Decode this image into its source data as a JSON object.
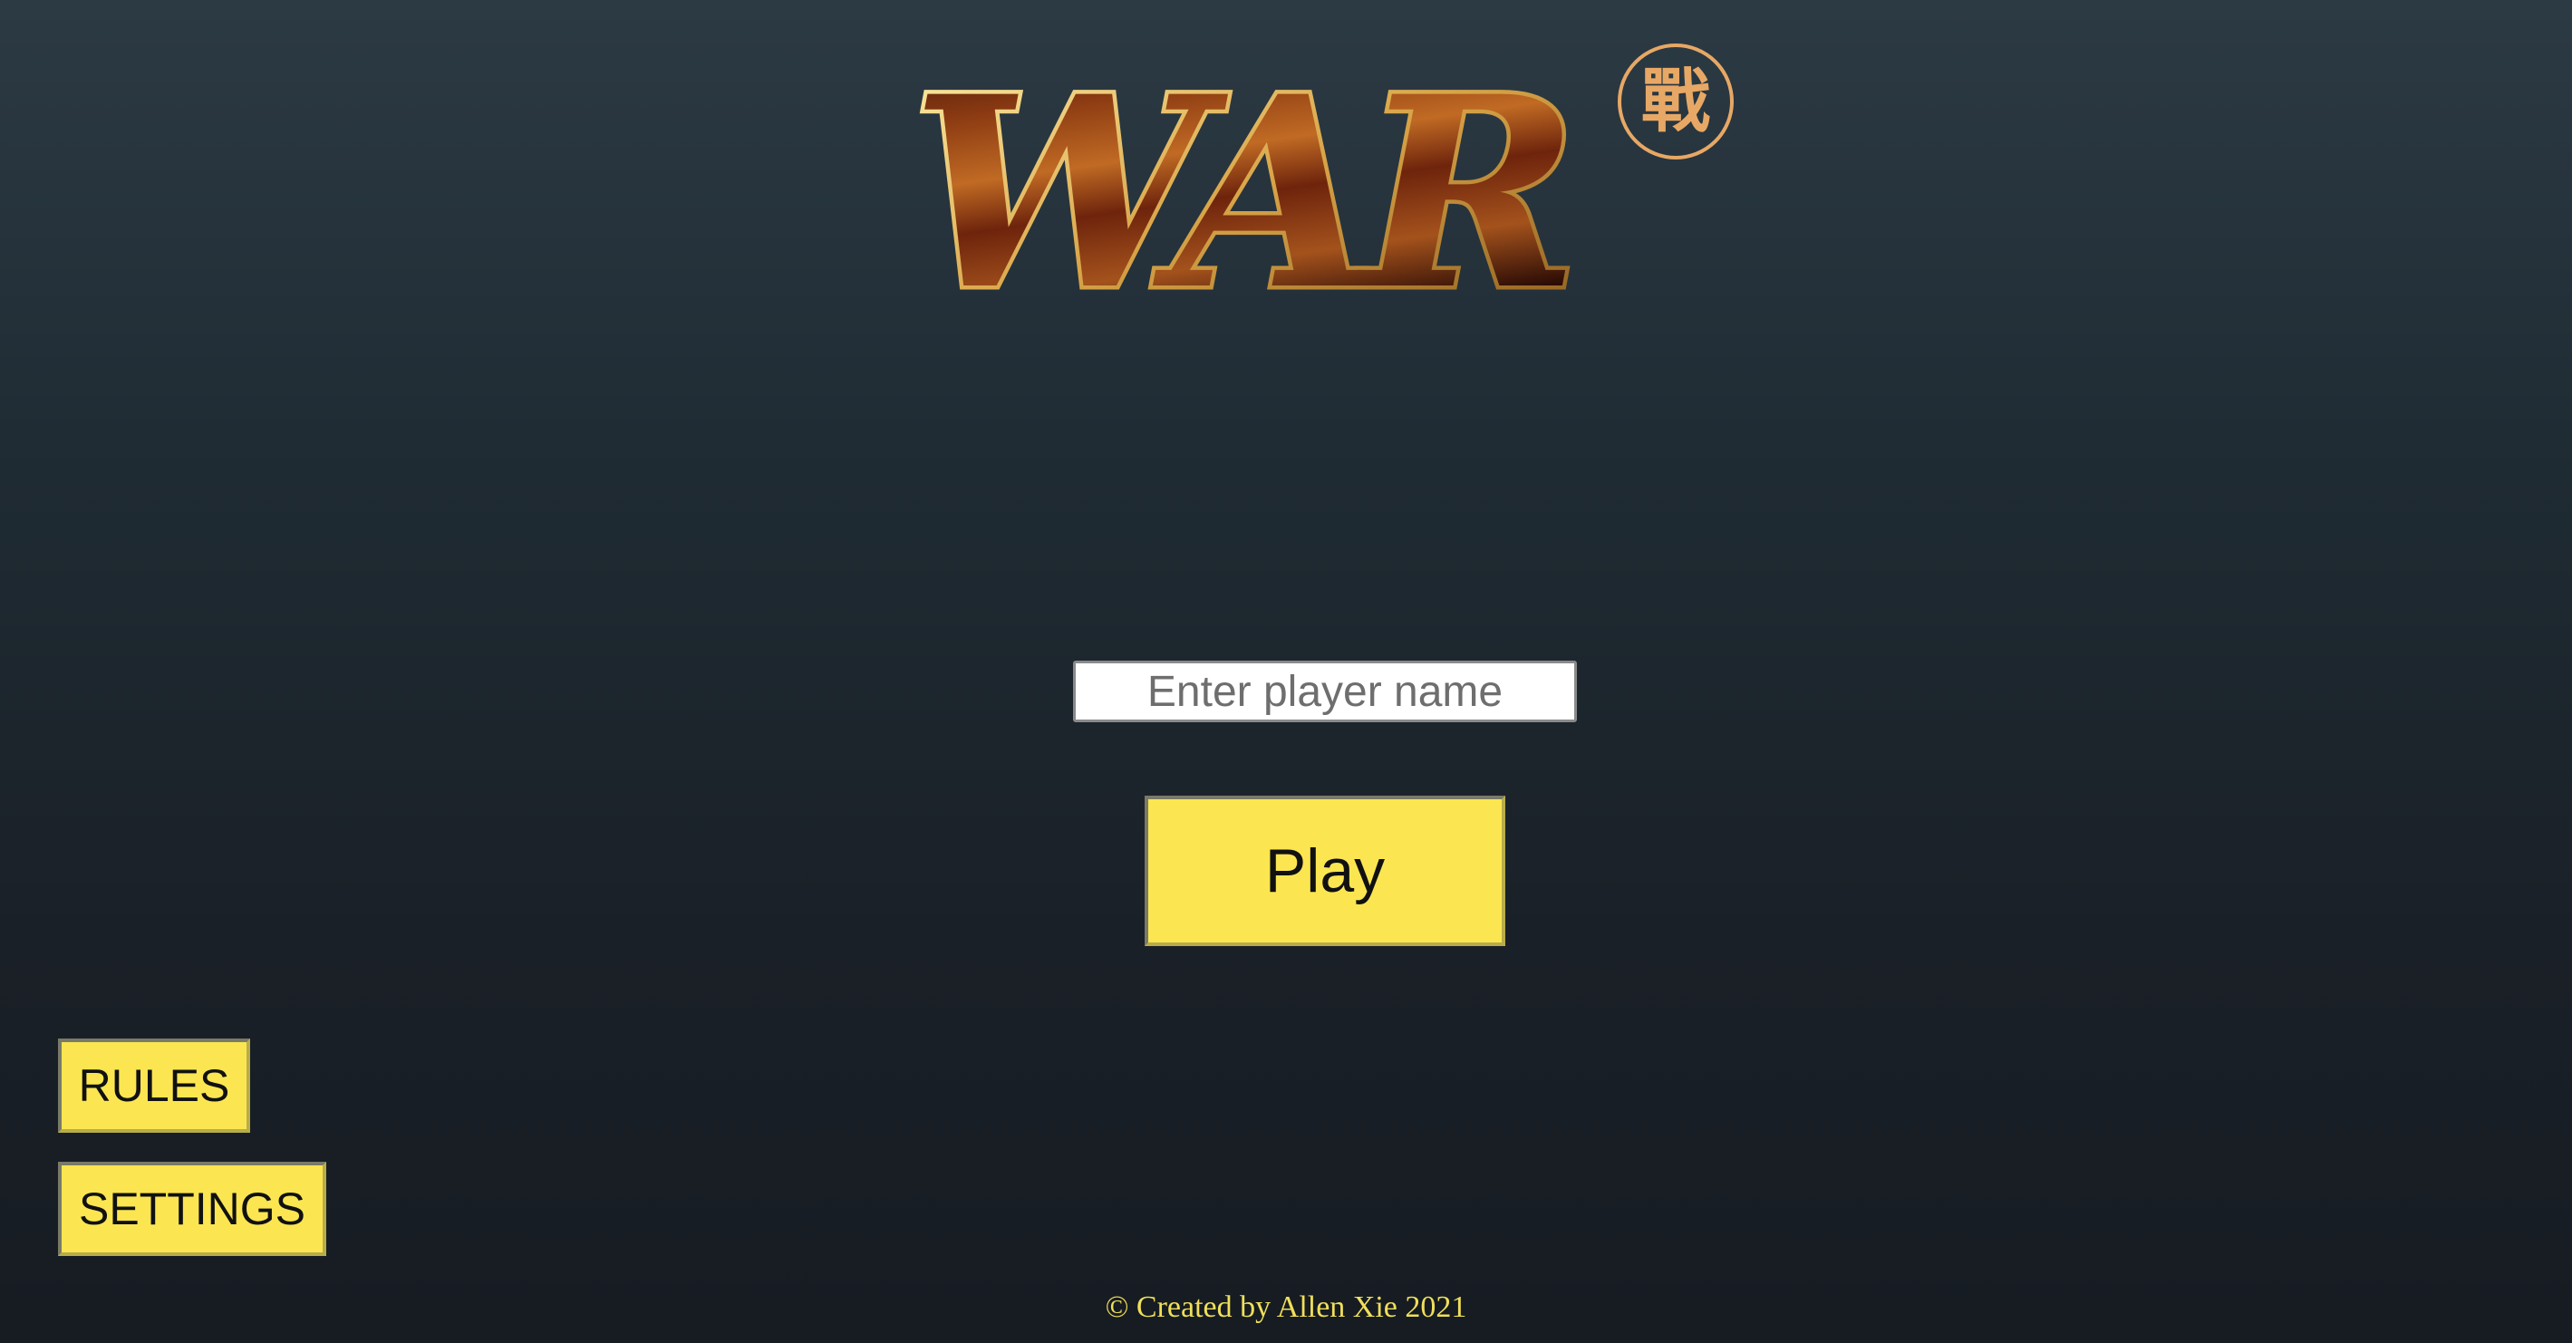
{
  "logo": {
    "title": "WAR",
    "seal_glyph": "戰"
  },
  "form": {
    "name_placeholder": "Enter player name",
    "name_value": ""
  },
  "buttons": {
    "play_label": "Play",
    "rules_label": "RULES",
    "settings_label": "SETTINGS"
  },
  "footer": {
    "credit": "© Created by Allen Xie 2021"
  },
  "colors": {
    "button_yellow": "#fbe651",
    "gold": "#e7a865",
    "footer_text": "#f1df5a",
    "background_top": "#2c3a44",
    "background_bottom": "#161c22"
  }
}
